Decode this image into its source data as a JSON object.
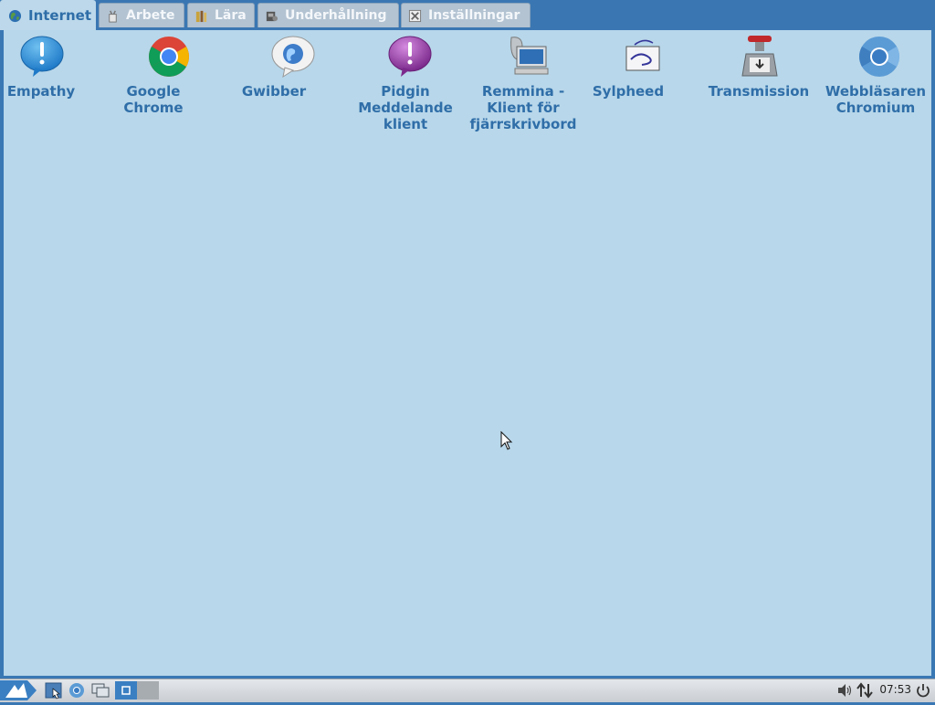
{
  "tabs": [
    {
      "label": "Internet",
      "icon": "globe-icon",
      "active": true
    },
    {
      "label": "Arbete",
      "icon": "work-icon",
      "active": false
    },
    {
      "label": "Lära",
      "icon": "books-icon",
      "active": false
    },
    {
      "label": "Underhållning",
      "icon": "media-icon",
      "active": false
    },
    {
      "label": "Inställningar",
      "icon": "settings-icon",
      "active": false
    }
  ],
  "apps": [
    {
      "label": "Empathy",
      "icon": "empathy-icon"
    },
    {
      "label": "Google Chrome",
      "icon": "chrome-icon"
    },
    {
      "label": "Gwibber",
      "icon": "gwibber-icon"
    },
    {
      "label": "Pidgin Meddelande klient",
      "icon": "pidgin-icon"
    },
    {
      "label": "Remmina - Klient för fjärrskrivbord",
      "icon": "remmina-icon"
    },
    {
      "label": "Sylpheed",
      "icon": "sylpheed-icon"
    },
    {
      "label": "Transmission",
      "icon": "transmission-icon"
    },
    {
      "label": "Webbläsaren Chromium",
      "icon": "chromium-icon"
    }
  ],
  "taskbar": {
    "clock": "07:53",
    "icons": [
      "start-menu-icon",
      "file-manager-icon",
      "browser-icon",
      "show-desktop-icon",
      "workspace-1-icon",
      "workspace-2-icon",
      "volume-icon",
      "network-icon",
      "power-icon"
    ]
  },
  "colors": {
    "accent": "#2f6ea8",
    "content_bg": "#b8d7ea",
    "tabbar_bg": "#3a76b2"
  }
}
